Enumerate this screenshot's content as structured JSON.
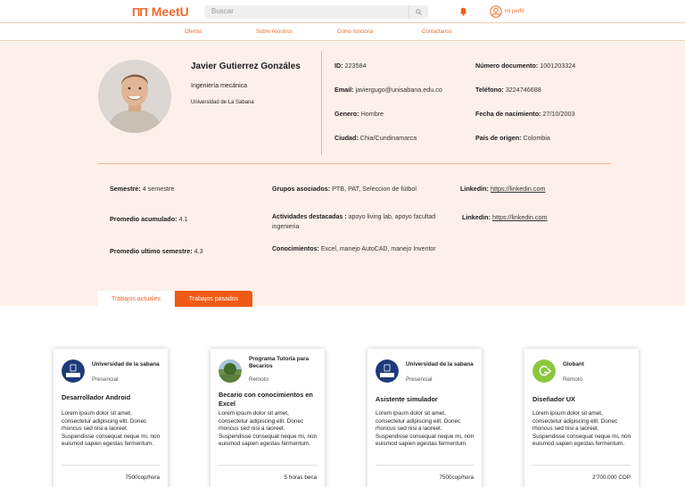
{
  "header": {
    "brand": "MeetU",
    "search_placeholder": "Buscar",
    "profile_label": "mi perfil",
    "brand_color": "#ef6a2a"
  },
  "nav": {
    "items": [
      "Ofertas",
      "Sobre nosotros",
      "Como funciona",
      "Contactanos"
    ]
  },
  "profile": {
    "name": "Javier Gutierrez Gonzáles",
    "career": "Ingeniería mecánica",
    "university": "Universidad de La Sabana",
    "id_label": "ID:",
    "id_value": "223584",
    "email_label": "Email:",
    "email_value": "javiergugo@unisabana.edu.co",
    "gender_label": "Genero:",
    "gender_value": "Hombre",
    "city_label": "Ciudad:",
    "city_value": "Chia/Cundinamarca",
    "doc_label": "Número documento:",
    "doc_value": "1001203324",
    "phone_label": "Teléfono:",
    "phone_value": "3224746688",
    "birth_label": "Fecha de nacimiento:",
    "birth_value": "27/10/2003",
    "country_label": "País de origen:",
    "country_value": "Colombia"
  },
  "academic": {
    "semester_label": "Semestre:",
    "semester_value": "4 semestre",
    "avg_label": "Promedio acumulado:",
    "avg_value": "4.1",
    "last_avg_label": "Promedio ultimo semestre:",
    "last_avg_value": "4.3",
    "groups_label": "Grupos asociados:",
    "groups_value": "PTB, PAT, Seleccion de fútbol",
    "activities_label": "Actividades destacadas :",
    "activities_value": "apoyo living lab, apoyo facultad ingenieria",
    "knowledge_label": "Conocimientos:",
    "knowledge_value": "Excel, manejo AutoCAD, manejo Inventor",
    "linkedin1_label": "Linkedin:",
    "linkedin1_value": "https://linkedin.com",
    "linkedin2_label": "Linkedin:",
    "linkedin2_value": "https://linkedin.com"
  },
  "tabs": {
    "current": "Trabajos actuales",
    "past": "Trabajos pasados"
  },
  "cards": [
    {
      "org": "Universidad de la sabana",
      "mode": "Presencial",
      "title": "Desarrollador Android",
      "desc": "Lorem ipsum dolor sit amet, consectetur adipiscing elit. Donec rhoncus sed nisi a laoreet. Suspendisse consequat neque mi, non euismod sapien egestas fermentum.",
      "price": "7500cop/hora"
    },
    {
      "org": "Programa Tutoria para Becarios",
      "mode": "Remoto",
      "title": "Becario con conocimientos en Excel",
      "desc": "Lorem ipsum dolor sit amet, consectetur adipiscing elit. Donec rhoncus sed nisi a laoreet. Suspendisse consequat neque mi, non euismod sapien egestas fermentum.",
      "price": "5 horas beca"
    },
    {
      "org": "Universidad de la sabana",
      "mode": "Presencial",
      "title": "Asistente simulador",
      "desc": "Lorem ipsum dolor sit amet, consectetur adipiscing elit. Donec rhoncus sed nisi a laoreet. Suspendisse consequat neque mi, non euismod sapien egestas fermentum.",
      "price": "7500cop/hora"
    },
    {
      "org": "Globant",
      "mode": "Remoto",
      "title": "Diseñador UX",
      "desc": "Lorem ipsum dolor sit amet, consectetur adipiscing elit. Donec rhoncus sed nisi a laoreet. Suspendisse consequat neque mi, non euismod sapien egestas fermentum.",
      "price": "2'700.000 COP"
    }
  ]
}
